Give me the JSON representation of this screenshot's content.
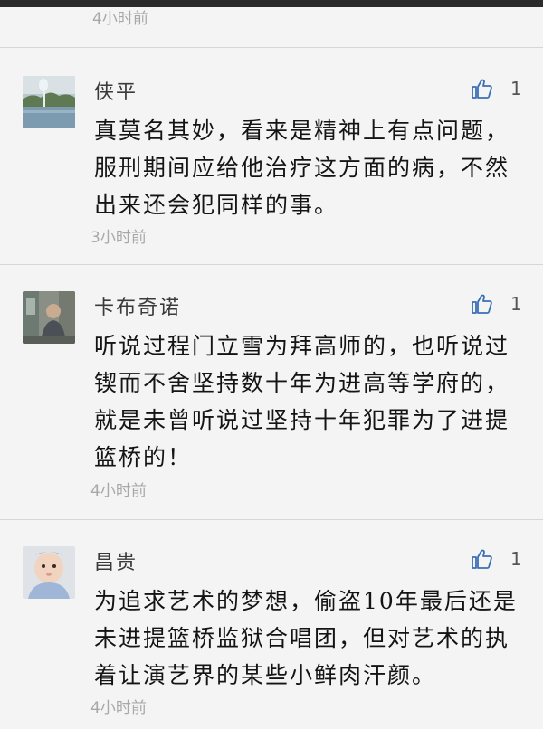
{
  "top": {
    "time": "4小时前"
  },
  "comments": [
    {
      "name": "侠平",
      "likes": "1",
      "text": "真莫名其妙，看来是精神上有点问题，\n服刑期间应给他治疗这方面的病，不然\n出来还会犯同样的事。",
      "time": "3小时前"
    },
    {
      "name": "卡布奇诺",
      "likes": "1",
      "text": "听说过程门立雪为拜高师的，也听说过\n锲而不舍坚持数十年为进高等学府的，\n就是未曾听说过坚持十年犯罪为了进提\n篮桥的！",
      "time": "4小时前"
    },
    {
      "name": "昌贵",
      "likes": "1",
      "text": "为追求艺术的梦想，偷盗10年最后还是\n未进提篮桥监狱合唱团，但对艺术的执\n着让演艺界的某些小鲜肉汗颜。",
      "time": "4小时前"
    }
  ],
  "icons": {
    "like": "thumbs-up-icon"
  },
  "colors": {
    "accent": "#3b6fb6",
    "background": "#f4f4f4",
    "meta": "#a8a8a8"
  }
}
